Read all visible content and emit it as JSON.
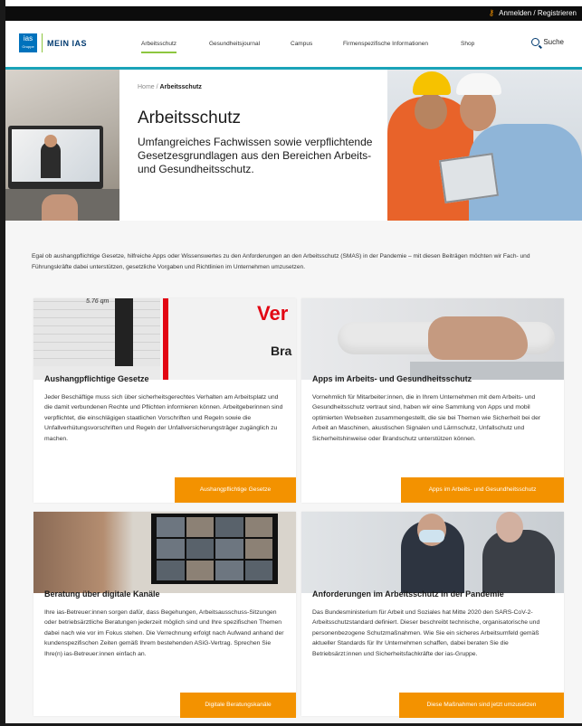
{
  "topbar": {
    "login_label": "Anmelden / Registrieren"
  },
  "header": {
    "logo_main": "ias",
    "logo_sub": "Gruppe",
    "logo_text": "MEIN IAS",
    "nav": [
      {
        "label": "Arbeitsschutz",
        "active": true
      },
      {
        "label": "Gesundheitsjournal",
        "active": false
      },
      {
        "label": "Campus",
        "active": false
      },
      {
        "label": "Firmenspezifische Informationen",
        "active": false
      },
      {
        "label": "Shop",
        "active": false
      }
    ],
    "search_label": "Suche"
  },
  "hero": {
    "breadcrumb_home": "Home",
    "breadcrumb_sep": " / ",
    "breadcrumb_current": "Arbeitsschutz",
    "title": "Arbeitsschutz",
    "subtitle": "Umfangreiches Fachwissen sowie verpflichtende Gesetzesgrundlagen aus den Bereichen Arbeits- und Gesundheitsschutz."
  },
  "intro": "Egal ob aushangpflichtige Gesetze, hilfreiche Apps oder Wissenswertes zu den Anforderungen an den Arbeitsschutz (SMAS) in der Pandemie – mit diesen Beiträgen möchten wir Fach- und Führungskräfte dabei unterstützen, gesetzliche Vorgaben und Richtlinien im Unternehmen umzusetzen.",
  "cards": [
    {
      "title": "Aushangpflichtige Gesetze",
      "text": "Jeder Beschäftige muss sich über sicherheitsgerechtes Verhalten am Arbeitsplatz und die damit verbundenen Rechte und Pflichten informieren können. Arbeitgeberinnen sind verpflichtet, die einschlägigen staatlichen Vorschriften und Regeln sowie die Unfallverhütungsvorschriften und Regeln der Unfallversicherungsträger zugänglich zu machen.",
      "button": "Aushangpflichtige Gesetze",
      "image_text_1": "5.76 qm",
      "image_text_2": "Ver",
      "image_text_3": "Bra"
    },
    {
      "title": "Apps im Arbeits- und Gesundheitsschutz",
      "text": "Vornehmlich für Mitarbeiter:innen, die in Ihrem Unternehmen mit dem Arbeits- und Gesundheitsschutz vertraut sind, haben wir eine Sammlung von Apps und mobil optimierten Webseiten zusammengestellt, die sie bei Themen wie Sicherheit bei der Arbeit an Maschinen, akustischen Signalen und Lärmschutz, Unfallschutz und Sicherheitshinweise oder Brandschutz unterstützen können.",
      "button": "Apps im Arbeits- und Gesundheitsschutz"
    },
    {
      "title": "Beratung über digitale Kanäle",
      "text": "Ihre ias-Betreuer:innen sorgen dafür, dass Begehungen, Arbeitsausschuss-Sitzungen oder betriebsärztliche Beratungen jederzeit möglich sind und Ihre spezifischen Themen dabei nach wie vor im Fokus stehen. Die Verrechnung erfolgt nach Aufwand anhand der kundenspezifischen Zeiten gemäß Ihrem bestehenden ASiG-Vertrag. Sprechen Sie Ihre(n) ias-Betreuer:innen einfach an.",
      "button": "Digitale Beratungskanäle"
    },
    {
      "title": "Anforderungen im Arbeitsschutz in der Pandemie",
      "text": "Das Bundesministerium für Arbeit und Soziales hat Mitte 2020 den SARS-CoV-2-Arbeitsschutzstandard definiert. Dieser beschreibt technische, organisatorische und personenbezogene Schutzmaßnahmen. Wie Sie ein sicheres Arbeitsumfeld gemäß aktueller Standards für Ihr Unternehmen schaffen, dabei beraten Sie die Betriebsärzt:innen und Sicherheitsfachkräfte der ias-Gruppe.",
      "button": "Diese Maßnahmen sind jetzt umzusetzen"
    }
  ],
  "colors": {
    "accent": "#f39200",
    "brand_blue": "#0072bc",
    "teal": "#1aa3b8",
    "nav_active": "#8dc63f"
  }
}
